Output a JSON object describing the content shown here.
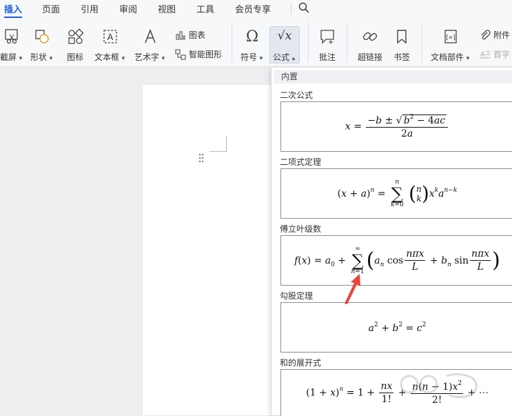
{
  "menu": {
    "tabs": [
      "插入",
      "页面",
      "引用",
      "审阅",
      "视图",
      "工具",
      "会员专享"
    ],
    "active_tab": "插入"
  },
  "ribbon": {
    "screenshot": "截屏",
    "shape": "形状",
    "icon": "图标",
    "textbox": "文本框",
    "wordart": "艺术字",
    "chart": "图表",
    "smartart": "智能图形",
    "symbol": "符号",
    "formula": "公式",
    "comment": "批注",
    "hyperlink": "超链接",
    "bookmark": "书签",
    "doc_parts": "文档部件",
    "attachment": "附件",
    "dropcap": "首字"
  },
  "formula_panel": {
    "header": "内置",
    "categories": [
      {
        "name": "二次公式"
      },
      {
        "name": "二项式定理"
      },
      {
        "name": "傅立叶级数"
      },
      {
        "name": "勾股定理"
      },
      {
        "name": "和的展开式"
      }
    ]
  },
  "colors": {
    "accent": "#1d5fd6",
    "arrow": "#e8443a"
  },
  "icons": {
    "search": "search-icon",
    "drag": "drag-handle-icon"
  }
}
